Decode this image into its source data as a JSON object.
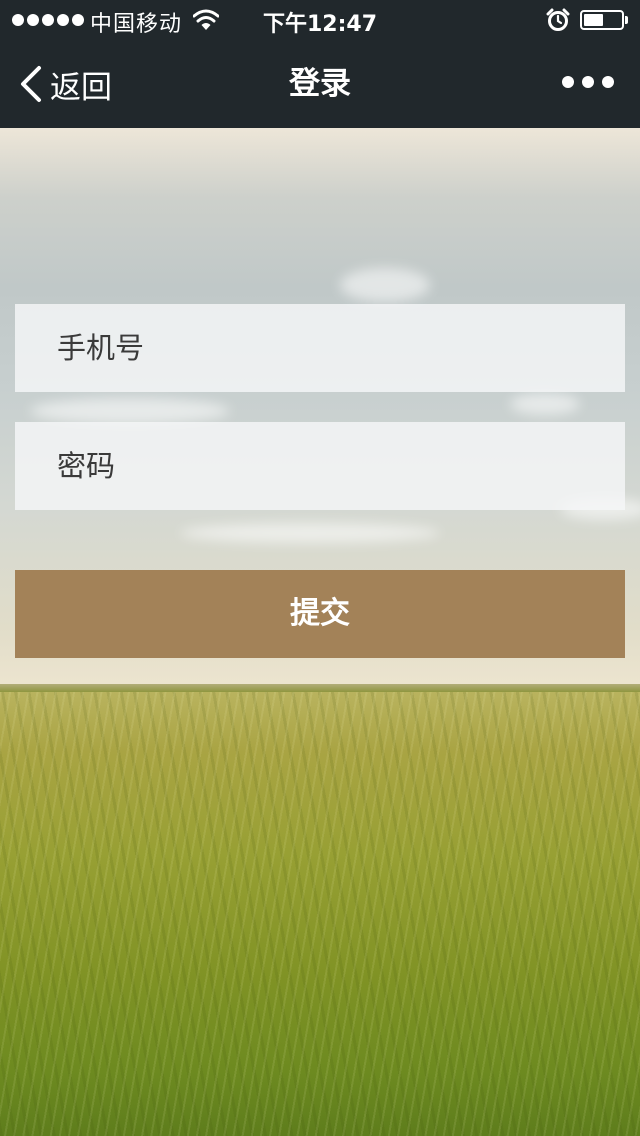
{
  "status_bar": {
    "carrier": "中国移动",
    "time": "下午12:47",
    "battery_level": 0.48,
    "icons": [
      "signal-dots-icon",
      "wifi-icon",
      "alarm-icon",
      "battery-icon"
    ]
  },
  "nav": {
    "back_label": "返回",
    "title": "登录",
    "icons": [
      "chevron-left-icon",
      "more-dots-icon"
    ]
  },
  "form": {
    "phone_placeholder": "手机号",
    "phone_value": "",
    "password_placeholder": "密码",
    "password_value": "",
    "submit_label": "提交"
  },
  "colors": {
    "topbar": "#21282c",
    "submit_button": "#a38258"
  }
}
